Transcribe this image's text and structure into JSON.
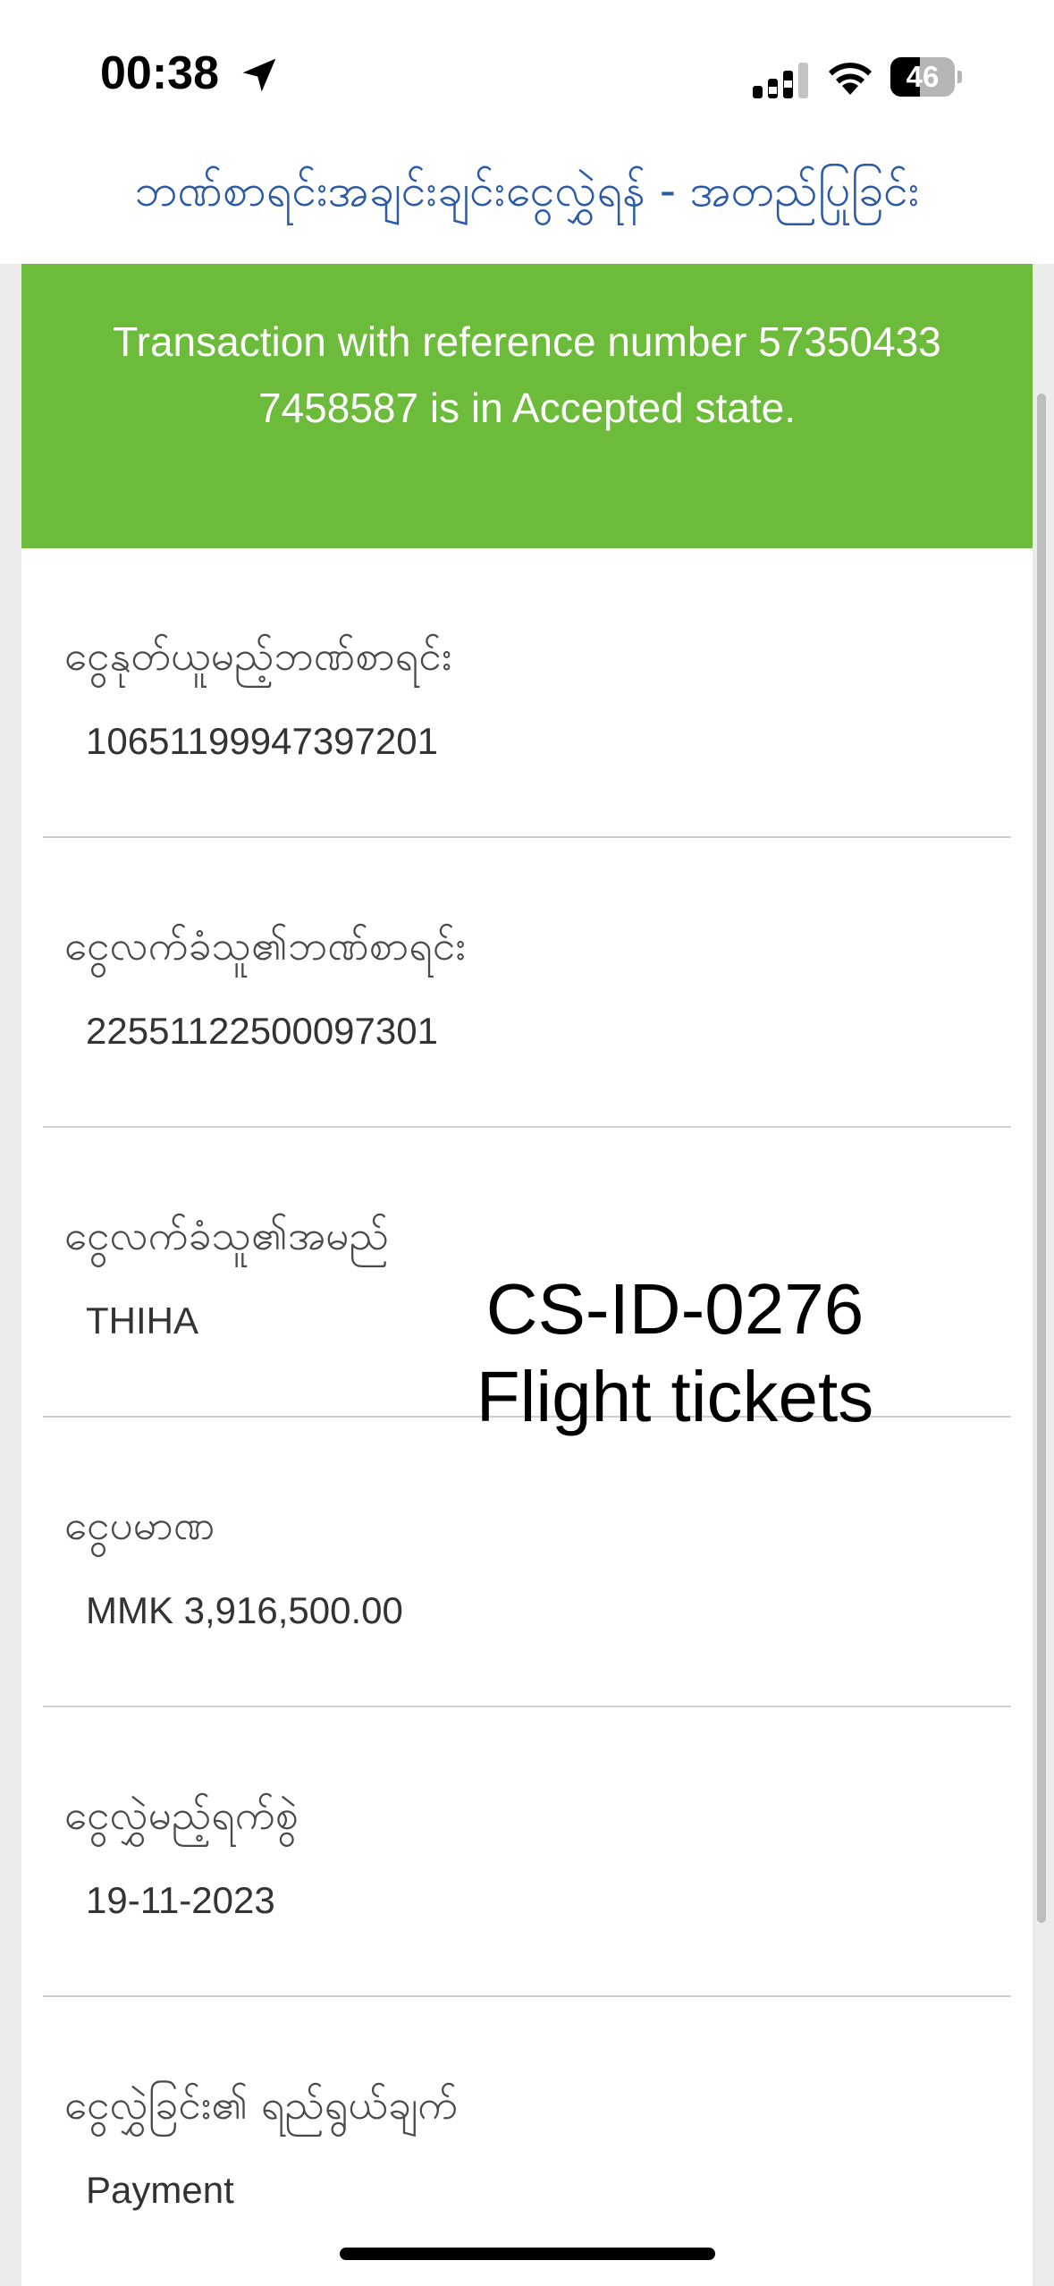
{
  "status_bar": {
    "time": "00:38",
    "battery_level": "46",
    "battery_fraction": 0.46
  },
  "header": {
    "title": "ဘဏ်စာရင်းအချင်းချင်းငွေလွှဲရန် - အတည်ပြုခြင်း"
  },
  "banner": {
    "message": "Transaction with reference  number 57350433 7458587 is in Accepted state.",
    "color": "#6dbb3a"
  },
  "fields": [
    {
      "label": "ငွေနုတ်ယူမည့်ဘဏ်စာရင်း",
      "value": "10651199947397201"
    },
    {
      "label": "ငွေလက်ခံသူ၏ဘဏ်စာရင်း",
      "value": "22551122500097301"
    },
    {
      "label": "ငွေလက်ခံသူ၏အမည်",
      "value": "THIHA"
    },
    {
      "label": "ငွေပမာဏ",
      "value": "MMK 3,916,500.00"
    },
    {
      "label": "ငွေလွှဲမည့်ရက်စွဲ",
      "value": "19-11-2023"
    },
    {
      "label": "ငွေလွှဲခြင်း၏ ရည်ရွယ်ချက်",
      "value": "Payment"
    }
  ],
  "overlay": {
    "line1": "CS-ID-0276",
    "line2": "Flight tickets"
  },
  "icons": {
    "location": "location-arrow-icon",
    "signal": "cellular-signal-icon",
    "wifi": "wifi-icon",
    "battery": "battery-icon"
  }
}
